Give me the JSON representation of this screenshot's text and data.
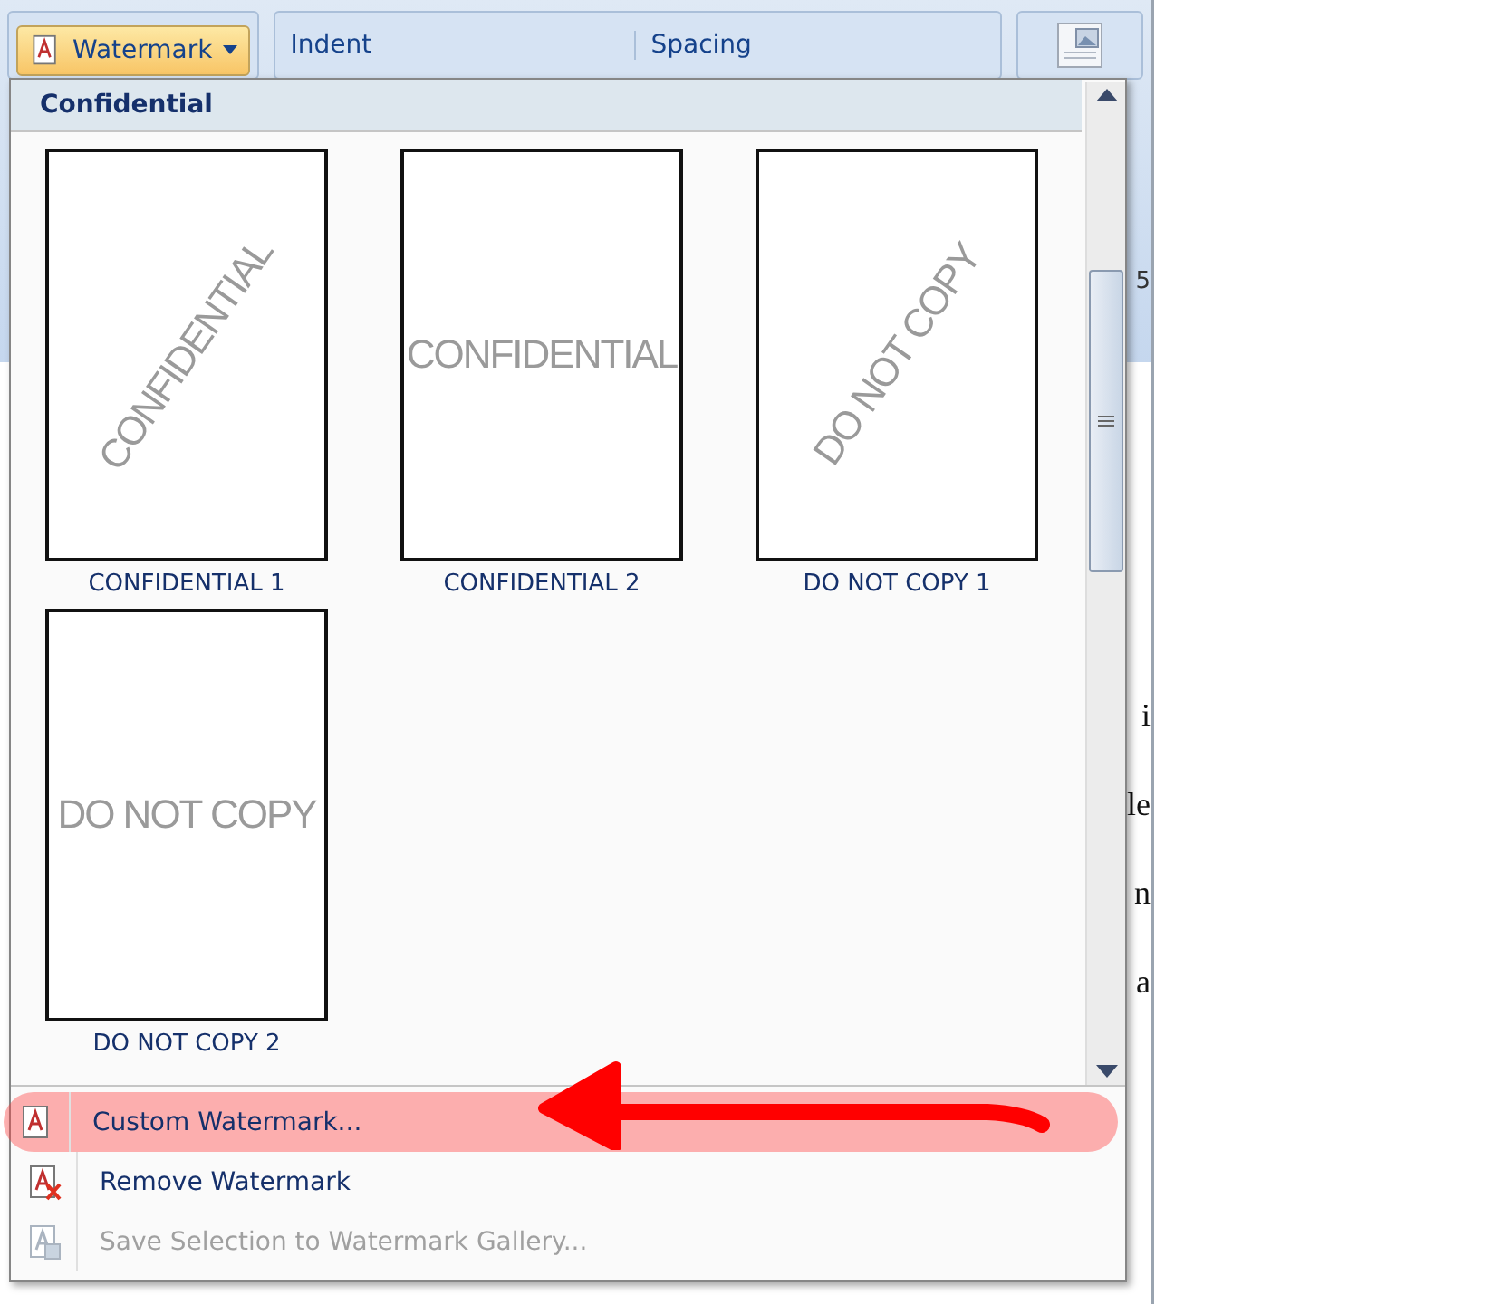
{
  "ribbon": {
    "watermark_button": {
      "label": "Watermark",
      "selected": true
    },
    "groups": [
      {
        "label": "Indent"
      },
      {
        "label": "Spacing"
      }
    ],
    "cut_text": "5"
  },
  "document": {
    "fragments": [
      "i",
      "le",
      "n",
      "a"
    ]
  },
  "menu": {
    "section_title": "Confidential",
    "gallery": [
      {
        "text": "CONFIDENTIAL",
        "caption": "CONFIDENTIAL 1",
        "kind": "diagonal"
      },
      {
        "text": "CONFIDENTIAL",
        "caption": "CONFIDENTIAL 2",
        "kind": "horizontal"
      },
      {
        "text": "DO NOT COPY",
        "caption": "DO NOT COPY 1",
        "kind": "diagonal"
      },
      {
        "text": "DO NOT COPY",
        "caption": "DO NOT COPY 2",
        "kind": "horizontal"
      }
    ],
    "items": [
      {
        "label": "Custom Watermark...",
        "kind": "custom",
        "disabled": false,
        "highlighted": true
      },
      {
        "label": "Remove Watermark",
        "kind": "remove",
        "disabled": false,
        "highlighted": false
      },
      {
        "label": "Save Selection to Watermark Gallery...",
        "kind": "save",
        "disabled": true,
        "highlighted": false
      }
    ]
  }
}
